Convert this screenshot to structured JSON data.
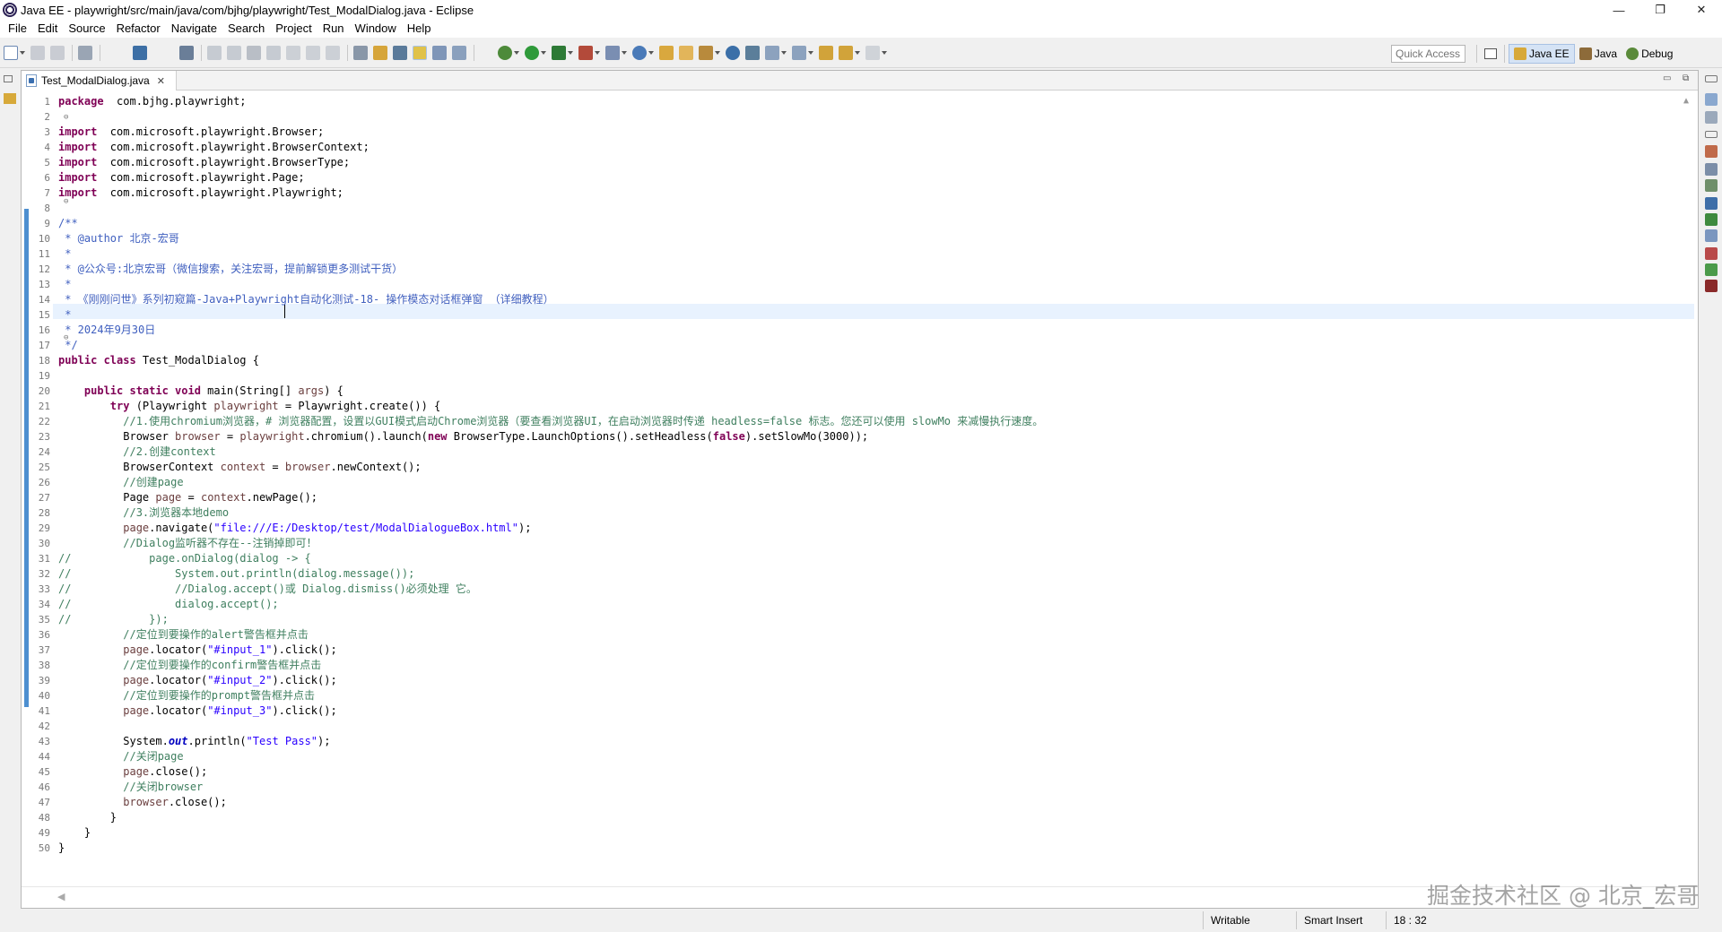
{
  "window": {
    "title": "Java EE - playwright/src/main/java/com/bjhg/playwright/Test_ModalDialog.java - Eclipse",
    "min_glyph": "—",
    "max_glyph": "❐",
    "close_glyph": "✕"
  },
  "menu": [
    "File",
    "Edit",
    "Source",
    "Refactor",
    "Navigate",
    "Search",
    "Project",
    "Run",
    "Window",
    "Help"
  ],
  "toolbar": {
    "quick_access_placeholder": "Quick Access",
    "perspectives": [
      {
        "label": "Java EE",
        "active": true
      },
      {
        "label": "Java",
        "active": false
      },
      {
        "label": "Debug",
        "active": false
      }
    ]
  },
  "editor": {
    "tab_label": "Test_ModalDialog.java",
    "tab_close": "✕",
    "minimize_glyph": "▭",
    "maximize_glyph": "⧉",
    "line_numbers": [
      "1",
      "2",
      "3",
      "4",
      "5",
      "6",
      "7",
      "8",
      "9",
      "10",
      "11",
      "12",
      "13",
      "14",
      "15",
      "16",
      "17",
      "18",
      "19",
      "20",
      "21",
      "22",
      "23",
      "24",
      "25",
      "26",
      "27",
      "28",
      "29",
      "30",
      "31",
      "32",
      "33",
      "34",
      "35",
      "36",
      "37",
      "38",
      "39",
      "40",
      "41",
      "42",
      "43",
      "44",
      "45",
      "46",
      "47",
      "48",
      "49",
      "50"
    ],
    "lines": [
      [
        [
          "kw",
          "package"
        ],
        [
          "",
          "  com.bjhg.playwright;"
        ]
      ],
      [],
      [
        [
          "kw",
          "import"
        ],
        [
          "",
          "  com.microsoft.playwright.Browser;"
        ]
      ],
      [
        [
          "kw",
          "import"
        ],
        [
          "",
          "  com.microsoft.playwright.BrowserContext;"
        ]
      ],
      [
        [
          "kw",
          "import"
        ],
        [
          "",
          "  com.microsoft.playwright.BrowserType;"
        ]
      ],
      [
        [
          "kw",
          "import"
        ],
        [
          "",
          "  com.microsoft.playwright.Page;"
        ]
      ],
      [
        [
          "kw",
          "import"
        ],
        [
          "",
          "  com.microsoft.playwright.Playwright;"
        ]
      ],
      [],
      [
        [
          "jd",
          "/**"
        ]
      ],
      [
        [
          "jd",
          " * @author 北京-宏哥"
        ]
      ],
      [
        [
          "jd",
          " *"
        ]
      ],
      [
        [
          "jd",
          " * @公众号:北京宏哥（微信搜索，关注宏哥，提前解锁更多测试干货）"
        ]
      ],
      [
        [
          "jd",
          " *"
        ]
      ],
      [
        [
          "jd",
          " * 《刚刚问世》系列初窥篇-Java+Playwright自动化测试-18- 操作模态对话框弹窗 （详细教程）"
        ]
      ],
      [
        [
          "jd",
          " *"
        ]
      ],
      [
        [
          "jd",
          " * 2024年9月30日"
        ]
      ],
      [
        [
          "jd",
          " */"
        ]
      ],
      [
        [
          "kw",
          "public class"
        ],
        [
          "",
          " Test_ModalDialog {"
        ]
      ],
      [],
      [
        [
          "",
          "    "
        ],
        [
          "kw",
          "public static void"
        ],
        [
          "",
          " main(String[] "
        ],
        [
          "var",
          "args"
        ],
        [
          "",
          ") {"
        ]
      ],
      [
        [
          "",
          "        "
        ],
        [
          "kw",
          "try"
        ],
        [
          "",
          " (Playwright "
        ],
        [
          "var",
          "playwright"
        ],
        [
          "",
          " = Playwright.create()) {"
        ]
      ],
      [
        [
          "",
          "          "
        ],
        [
          "cmt",
          "//1.使用chromium浏览器，# 浏览器配置，设置以GUI模式启动Chrome浏览器（要查看浏览器UI，在启动浏览器时传递 headless=false 标志。您还可以使用 slowMo 来减慢执行速度。"
        ]
      ],
      [
        [
          "",
          "          Browser "
        ],
        [
          "var",
          "browser"
        ],
        [
          "",
          " = "
        ],
        [
          "var",
          "playwright"
        ],
        [
          "",
          ".chromium().launch("
        ],
        [
          "kw",
          "new"
        ],
        [
          "",
          " BrowserType.LaunchOptions().setHeadless("
        ],
        [
          "kw",
          "false"
        ],
        [
          "",
          ").setSlowMo(3000));"
        ]
      ],
      [
        [
          "",
          "          "
        ],
        [
          "cmt",
          "//2.创建context"
        ]
      ],
      [
        [
          "",
          "          BrowserContext "
        ],
        [
          "var",
          "context"
        ],
        [
          "",
          " = "
        ],
        [
          "var",
          "browser"
        ],
        [
          "",
          ".newContext();"
        ]
      ],
      [
        [
          "",
          "          "
        ],
        [
          "cmt",
          "//创建page"
        ]
      ],
      [
        [
          "",
          "          Page "
        ],
        [
          "var",
          "page"
        ],
        [
          "",
          " = "
        ],
        [
          "var",
          "context"
        ],
        [
          "",
          ".newPage();"
        ]
      ],
      [
        [
          "",
          "          "
        ],
        [
          "cmt",
          "//3.浏览器本地demo"
        ]
      ],
      [
        [
          "",
          "          "
        ],
        [
          "var",
          "page"
        ],
        [
          "",
          ".navigate("
        ],
        [
          "str",
          "\"file:///E:/Desktop/test/ModalDialogueBox.html\""
        ],
        [
          "",
          ");"
        ]
      ],
      [
        [
          "",
          "          "
        ],
        [
          "cmt",
          "//Dialog监听器不存在--注销掉即可！"
        ]
      ],
      [
        [
          "cmt",
          "//            page.onDialog(dialog -> {"
        ]
      ],
      [
        [
          "cmt",
          "//                System.out.println(dialog.message());"
        ]
      ],
      [
        [
          "cmt",
          "//                //Dialog.accept()或 Dialog.dismiss()必须处理 它。"
        ]
      ],
      [
        [
          "cmt",
          "//                dialog.accept();"
        ]
      ],
      [
        [
          "cmt",
          "//            });"
        ]
      ],
      [
        [
          "",
          "          "
        ],
        [
          "cmt",
          "//定位到要操作的alert警告框并点击"
        ]
      ],
      [
        [
          "",
          "          "
        ],
        [
          "var",
          "page"
        ],
        [
          "",
          ".locator("
        ],
        [
          "str",
          "\"#input_1\""
        ],
        [
          "",
          ").click();"
        ]
      ],
      [
        [
          "",
          "          "
        ],
        [
          "cmt",
          "//定位到要操作的confirm警告框并点击"
        ]
      ],
      [
        [
          "",
          "          "
        ],
        [
          "var",
          "page"
        ],
        [
          "",
          ".locator("
        ],
        [
          "str",
          "\"#input_2\""
        ],
        [
          "",
          ").click();"
        ]
      ],
      [
        [
          "",
          "          "
        ],
        [
          "cmt",
          "//定位到要操作的prompt警告框并点击"
        ]
      ],
      [
        [
          "",
          "          "
        ],
        [
          "var",
          "page"
        ],
        [
          "",
          ".locator("
        ],
        [
          "str",
          "\"#input_3\""
        ],
        [
          "",
          ").click();"
        ]
      ],
      [],
      [
        [
          "",
          "          System."
        ],
        [
          "fld",
          "out"
        ],
        [
          "",
          ".println("
        ],
        [
          "str",
          "\"Test Pass\""
        ],
        [
          "",
          ");"
        ]
      ],
      [
        [
          "",
          "          "
        ],
        [
          "cmt",
          "//关闭page"
        ]
      ],
      [
        [
          "",
          "          "
        ],
        [
          "var",
          "page"
        ],
        [
          "",
          ".close();"
        ]
      ],
      [
        [
          "",
          "          "
        ],
        [
          "cmt",
          "//关闭browser"
        ]
      ],
      [
        [
          "",
          "          "
        ],
        [
          "var",
          "browser"
        ],
        [
          "",
          ".close();"
        ]
      ],
      [
        [
          "",
          "        }"
        ]
      ],
      [
        [
          "",
          "    }"
        ]
      ],
      [
        [
          "",
          "}"
        ]
      ]
    ]
  },
  "status": {
    "writable": "Writable",
    "insert_mode": "Smart Insert",
    "position": "18 : 32"
  },
  "watermark": "掘金技术社区 @ 北京_宏哥"
}
